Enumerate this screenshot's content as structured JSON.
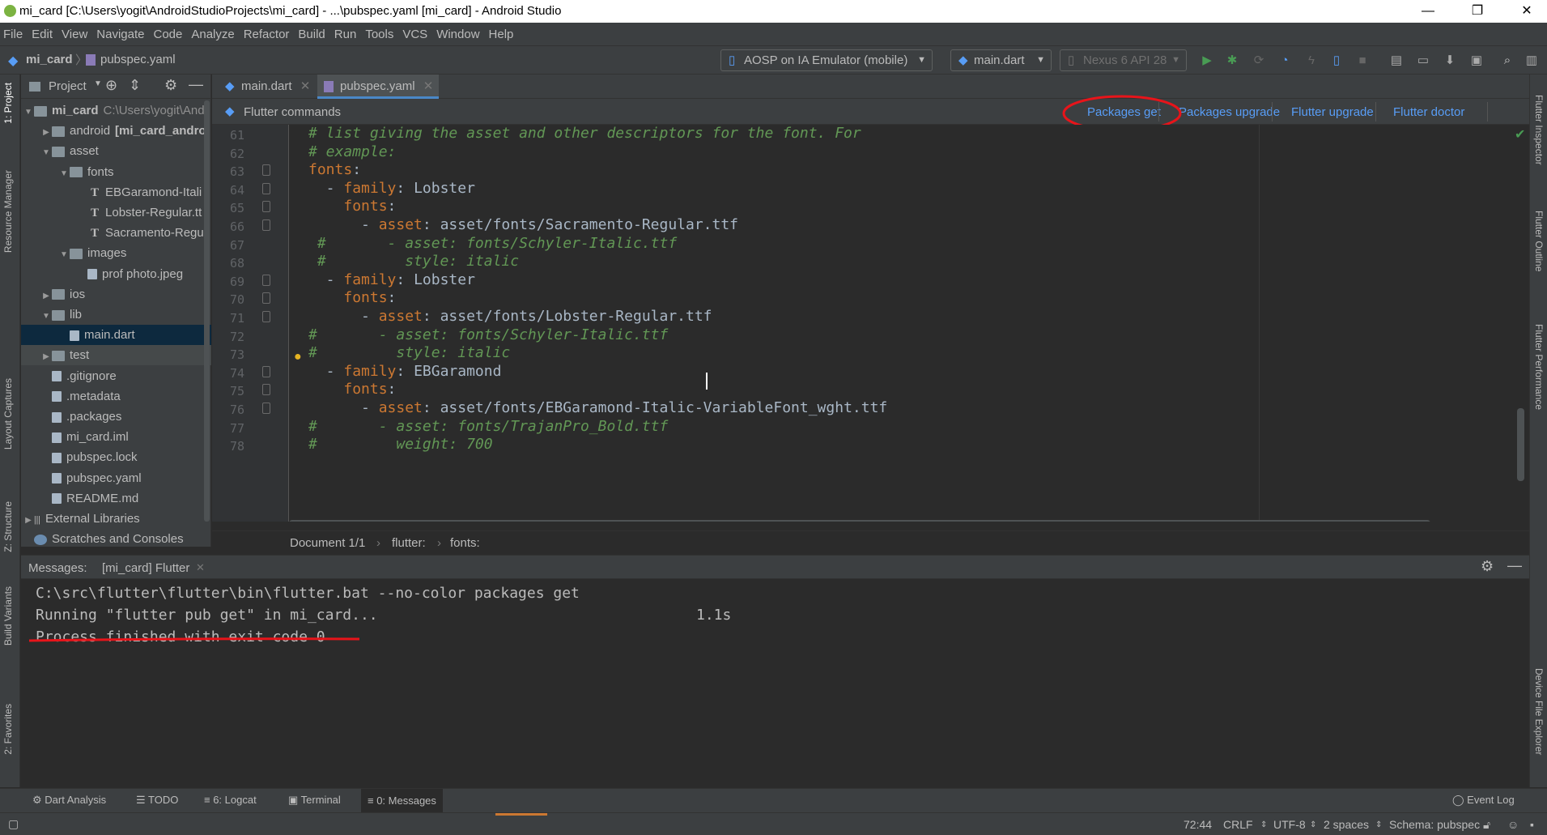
{
  "window": {
    "title": "mi_card [C:\\Users\\yogit\\AndroidStudioProjects\\mi_card] - ...\\pubspec.yaml [mi_card] - Android Studio"
  },
  "menu": [
    "File",
    "Edit",
    "View",
    "Navigate",
    "Code",
    "Analyze",
    "Refactor",
    "Build",
    "Run",
    "Tools",
    "VCS",
    "Window",
    "Help"
  ],
  "nav": {
    "project": "mi_card",
    "file": "pubspec.yaml",
    "device": "AOSP on IA Emulator (mobile)",
    "run_config": "main.dart",
    "avd": "Nexus 6 API 28"
  },
  "left_strip": [
    "1: Project",
    "Resource Manager",
    "Layout Captures",
    "Z: Structure",
    "Build Variants",
    "2: Favorites"
  ],
  "right_strip": [
    "Flutter Inspector",
    "Flutter Outline",
    "Flutter Performance",
    "Device File Explorer"
  ],
  "project_panel": {
    "title": "Project",
    "tree": [
      {
        "label": "mi_card",
        "extra": "C:\\Users\\yogit\\And",
        "kind": "folder",
        "depth": 0,
        "arrow": "down"
      },
      {
        "label": "android",
        "extra": "[mi_card_androi",
        "kind": "folder",
        "depth": 1,
        "arrow": "right"
      },
      {
        "label": "asset",
        "extra": "",
        "kind": "folder",
        "depth": 1,
        "arrow": "down"
      },
      {
        "label": "fonts",
        "extra": "",
        "kind": "folder",
        "depth": 2,
        "arrow": "down"
      },
      {
        "label": "EBGaramond-Itali",
        "extra": "",
        "kind": "font",
        "depth": 3,
        "arrow": ""
      },
      {
        "label": "Lobster-Regular.tt",
        "extra": "",
        "kind": "font",
        "depth": 3,
        "arrow": ""
      },
      {
        "label": "Sacramento-Regu",
        "extra": "",
        "kind": "font",
        "depth": 3,
        "arrow": ""
      },
      {
        "label": "images",
        "extra": "",
        "kind": "folder",
        "depth": 2,
        "arrow": "down"
      },
      {
        "label": "prof photo.jpeg",
        "extra": "",
        "kind": "file",
        "depth": 3,
        "arrow": ""
      },
      {
        "label": "ios",
        "extra": "",
        "kind": "folder",
        "depth": 1,
        "arrow": "right"
      },
      {
        "label": "lib",
        "extra": "",
        "kind": "folder",
        "depth": 1,
        "arrow": "down"
      },
      {
        "label": "main.dart",
        "extra": "",
        "kind": "file",
        "depth": 2,
        "arrow": "",
        "selected": true
      },
      {
        "label": "test",
        "extra": "",
        "kind": "folder",
        "depth": 1,
        "arrow": "right",
        "highlight": true
      },
      {
        "label": ".gitignore",
        "extra": "",
        "kind": "file",
        "depth": 1,
        "arrow": ""
      },
      {
        "label": ".metadata",
        "extra": "",
        "kind": "file",
        "depth": 1,
        "arrow": ""
      },
      {
        "label": ".packages",
        "extra": "",
        "kind": "file",
        "depth": 1,
        "arrow": ""
      },
      {
        "label": "mi_card.iml",
        "extra": "",
        "kind": "file",
        "depth": 1,
        "arrow": ""
      },
      {
        "label": "pubspec.lock",
        "extra": "",
        "kind": "file",
        "depth": 1,
        "arrow": ""
      },
      {
        "label": "pubspec.yaml",
        "extra": "",
        "kind": "file",
        "depth": 1,
        "arrow": ""
      },
      {
        "label": "README.md",
        "extra": "",
        "kind": "file",
        "depth": 1,
        "arrow": ""
      },
      {
        "label": "External Libraries",
        "extra": "",
        "kind": "lib",
        "depth": 0,
        "arrow": "right"
      },
      {
        "label": "Scratches and Consoles",
        "extra": "",
        "kind": "scratch",
        "depth": 0,
        "arrow": ""
      }
    ]
  },
  "editor": {
    "tabs": [
      {
        "label": "main.dart",
        "active": false
      },
      {
        "label": "pubspec.yaml",
        "active": true
      }
    ],
    "flutter_commands": {
      "title": "Flutter commands",
      "actions": [
        "Packages get",
        "Packages upgrade",
        "Flutter upgrade",
        "Flutter doctor"
      ]
    },
    "lines": [
      {
        "n": "61",
        "code": [
          {
            "t": "# list giving the asset and other descriptors for the font. For",
            "c": "cm"
          }
        ]
      },
      {
        "n": "62",
        "code": [
          {
            "t": "# example:",
            "c": "cm"
          }
        ]
      },
      {
        "n": "63",
        "code": [
          {
            "t": "fonts",
            "c": "ky"
          },
          {
            "t": ":",
            "c": "tx"
          }
        ]
      },
      {
        "n": "64",
        "code": [
          {
            "t": "  - ",
            "c": "tx"
          },
          {
            "t": "family",
            "c": "ky"
          },
          {
            "t": ": Lobster",
            "c": "tx"
          }
        ]
      },
      {
        "n": "65",
        "code": [
          {
            "t": "    ",
            "c": "tx"
          },
          {
            "t": "fonts",
            "c": "ky"
          },
          {
            "t": ":",
            "c": "tx"
          }
        ]
      },
      {
        "n": "66",
        "code": [
          {
            "t": "      - ",
            "c": "tx"
          },
          {
            "t": "asset",
            "c": "ky"
          },
          {
            "t": ": asset/fonts/Sacramento-Regular.ttf",
            "c": "tx"
          }
        ]
      },
      {
        "n": "67",
        "code": [
          {
            "t": " #       - asset: fonts/Schyler-Italic.ttf",
            "c": "cm"
          }
        ]
      },
      {
        "n": "68",
        "code": [
          {
            "t": " #         style: italic",
            "c": "cm"
          }
        ]
      },
      {
        "n": "69",
        "code": [
          {
            "t": "  - ",
            "c": "tx"
          },
          {
            "t": "family",
            "c": "ky"
          },
          {
            "t": ": Lobster",
            "c": "tx"
          }
        ]
      },
      {
        "n": "70",
        "code": [
          {
            "t": "    ",
            "c": "tx"
          },
          {
            "t": "fonts",
            "c": "ky"
          },
          {
            "t": ":",
            "c": "tx"
          }
        ]
      },
      {
        "n": "71",
        "code": [
          {
            "t": "      - ",
            "c": "tx"
          },
          {
            "t": "asset",
            "c": "ky"
          },
          {
            "t": ": asset/fonts/Lobster-Regular.ttf",
            "c": "tx"
          }
        ]
      },
      {
        "n": "72",
        "code": [
          {
            "t": "#       - asset: fonts/Schyler-Italic.ttf",
            "c": "cm"
          }
        ]
      },
      {
        "n": "73",
        "code": [
          {
            "t": "#         style: italic",
            "c": "cm"
          }
        ]
      },
      {
        "n": "74",
        "code": [
          {
            "t": "  - ",
            "c": "tx"
          },
          {
            "t": "family",
            "c": "ky"
          },
          {
            "t": ": EBGaramond",
            "c": "tx"
          }
        ]
      },
      {
        "n": "75",
        "code": [
          {
            "t": "    ",
            "c": "tx"
          },
          {
            "t": "fonts",
            "c": "ky"
          },
          {
            "t": ":",
            "c": "tx"
          }
        ]
      },
      {
        "n": "76",
        "code": [
          {
            "t": "      - ",
            "c": "tx"
          },
          {
            "t": "asset",
            "c": "ky"
          },
          {
            "t": ": asset/fonts/EBGaramond-Italic-VariableFont_wght.ttf",
            "c": "tx"
          }
        ]
      },
      {
        "n": "77",
        "code": [
          {
            "t": "#       - asset: fonts/TrajanPro_Bold.ttf",
            "c": "cm"
          }
        ]
      },
      {
        "n": "78",
        "code": [
          {
            "t": "#         weight: 700",
            "c": "cm"
          }
        ]
      }
    ],
    "breadcrumb": [
      "Document 1/1",
      "flutter:",
      "fonts:"
    ]
  },
  "messages": {
    "label": "Messages:",
    "tab": "[mi_card] Flutter",
    "lines": [
      "C:\\src\\flutter\\flutter\\bin\\flutter.bat --no-color packages get",
      "Running \"flutter pub get\" in mi_card...",
      "Process finished with exit code 0"
    ],
    "duration": "1.1s"
  },
  "bottom_tools": [
    "Dart Analysis",
    "TODO",
    "6: Logcat",
    "Terminal",
    "0: Messages"
  ],
  "event_log": "Event Log",
  "status": {
    "position": "72:44",
    "line_sep": "CRLF",
    "encoding": "UTF-8",
    "indent": "2 spaces",
    "schema": "Schema: pubspec"
  },
  "colors": {
    "annotation": "#e8141a",
    "accent": "#589df6"
  }
}
